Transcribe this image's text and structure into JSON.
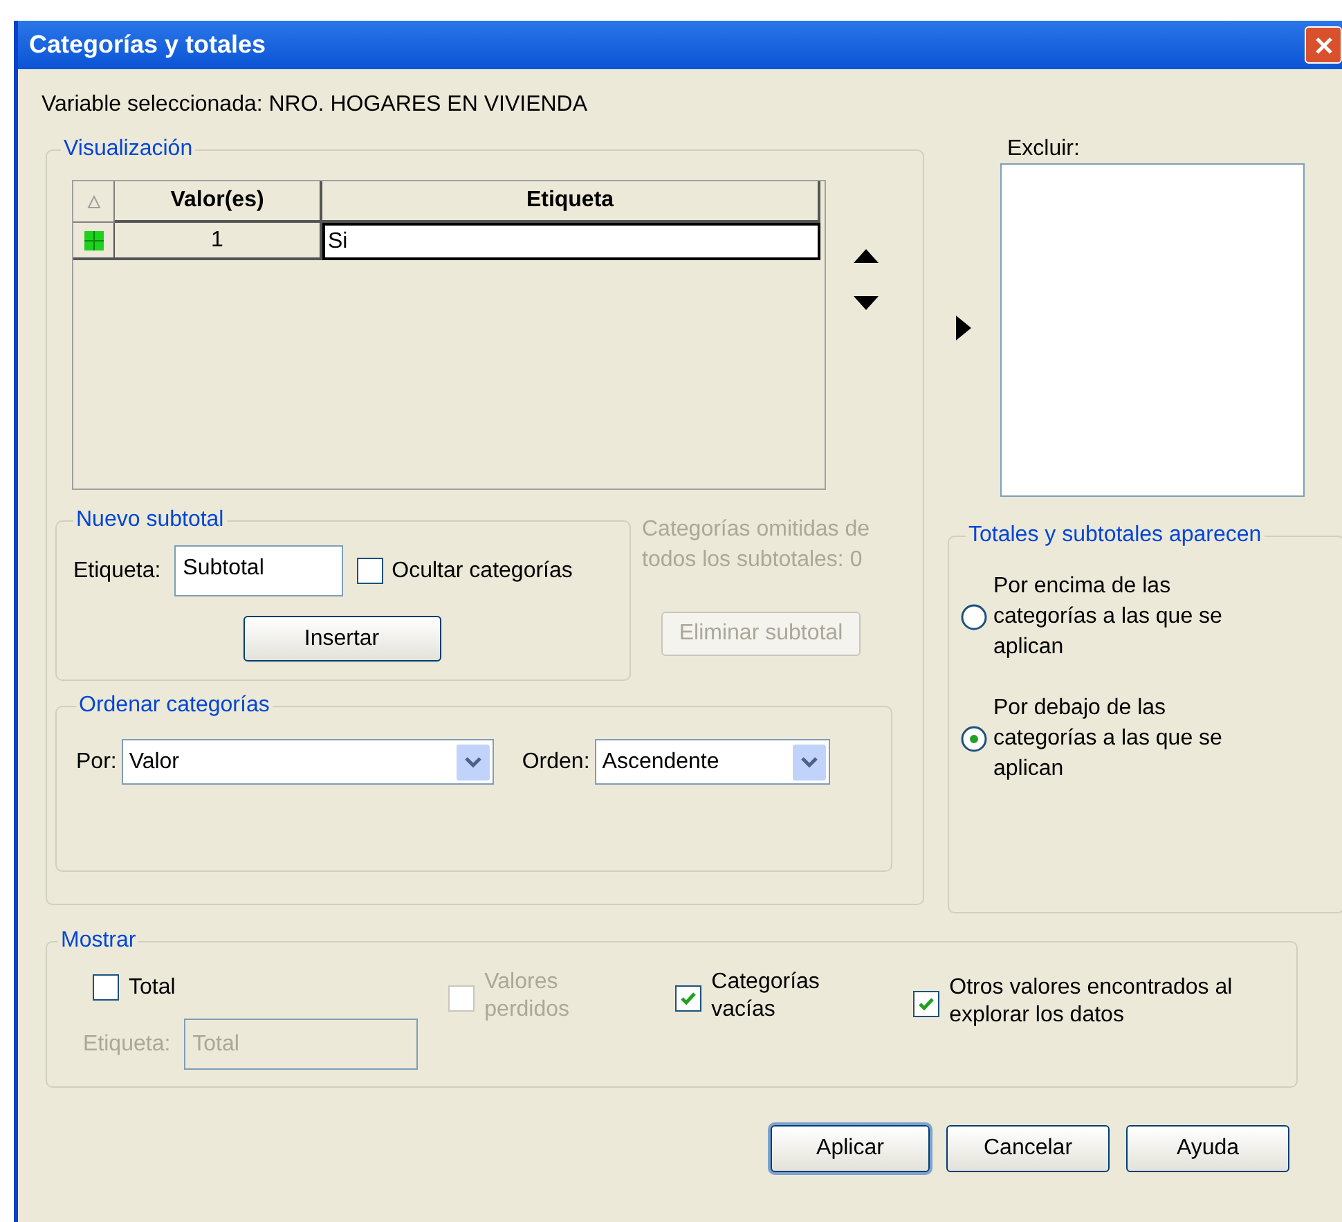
{
  "window": {
    "title": "Categorías y totales"
  },
  "variable_label": "Variable seleccionada: NRO. HOGARES EN VIVIENDA",
  "visualizacion": {
    "title": "Visualización",
    "table": {
      "columns": [
        "Valor(es)",
        "Etiqueta"
      ],
      "rows": [
        {
          "value": "1",
          "label": "Si"
        }
      ]
    }
  },
  "excluir": {
    "label": "Excluir:"
  },
  "nuevo_subtotal": {
    "title": "Nuevo subtotal",
    "field_label": "Etiqueta:",
    "value": "Subtotal",
    "hide": {
      "label": "Ocultar categorías",
      "checked": false
    },
    "insert_button": "Insertar"
  },
  "omitted_note": {
    "text": "Categorías omitidas de todos los subtotales: 0",
    "disabled": true
  },
  "remove_button": {
    "label": "Eliminar subtotal",
    "disabled": true
  },
  "ordenar": {
    "title": "Ordenar categorías",
    "by": {
      "label": "Por:",
      "value": "Valor"
    },
    "order": {
      "label": "Orden:",
      "value": "Ascendente"
    }
  },
  "totales": {
    "title": "Totales y subtotales aparecen",
    "options": [
      {
        "label": "Por encima de las categorías a las que se aplican",
        "selected": false
      },
      {
        "label": "Por debajo de las categorías a las que se aplican",
        "selected": true
      }
    ]
  },
  "mostrar": {
    "title": "Mostrar",
    "options": [
      {
        "label": "Total",
        "checked": false,
        "disabled": false
      },
      {
        "label": "Valores perdidos",
        "checked": false,
        "disabled": true
      },
      {
        "label": "Categorías vacías",
        "checked": true,
        "disabled": false
      },
      {
        "label": "Otros valores encontrados al explorar los datos",
        "checked": true,
        "disabled": false
      }
    ],
    "label_field": {
      "label": "Etiqueta:",
      "value": "Total",
      "disabled": true
    }
  },
  "buttons": [
    "Aplicar",
    "Cancelar",
    "Ayuda"
  ]
}
